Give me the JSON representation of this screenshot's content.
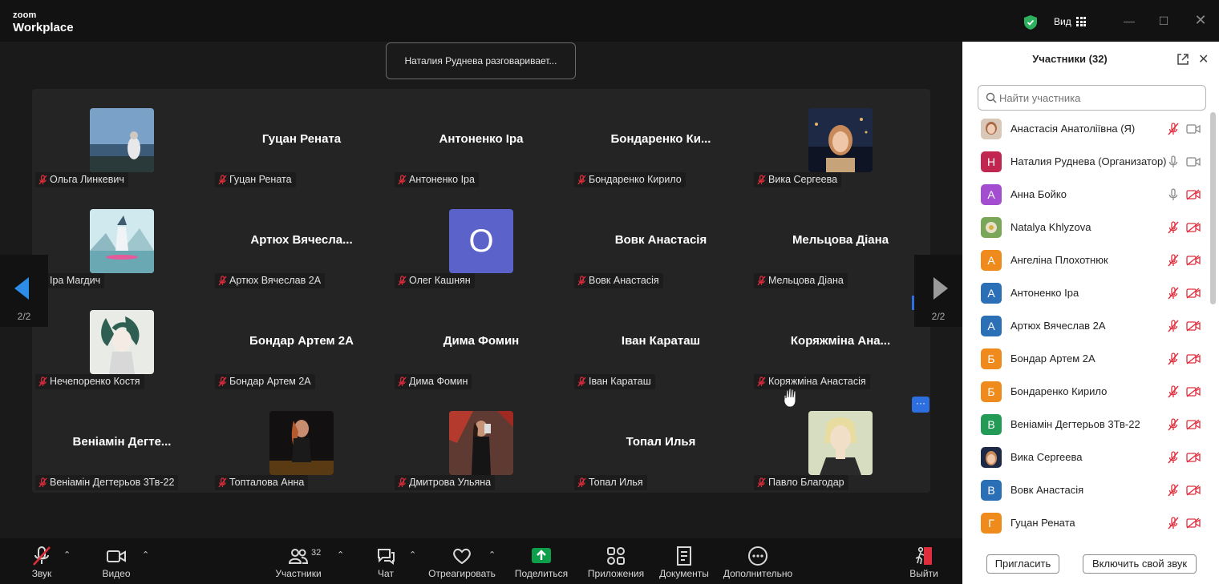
{
  "titlebar": {
    "brand_top": "zoom",
    "brand_bottom": "Workplace",
    "view_label": "Вид",
    "colors": {
      "shield": "#2db15f",
      "background": "#121212"
    }
  },
  "speaking_banner": "Наталия Руднева разговаривает...",
  "gallery": {
    "page": "2/2",
    "tiles": [
      {
        "display": "photo",
        "photo": "sea",
        "label": "Ольга Линкевич",
        "muted": true
      },
      {
        "display": "name",
        "big_name": "Гуцан Рената",
        "label": "Гуцан Рената",
        "muted": true
      },
      {
        "display": "name",
        "big_name": "Антоненко Іра",
        "label": "Антоненко Іра",
        "muted": true
      },
      {
        "display": "name",
        "big_name": "Бондаренко  Ки...",
        "label": "Бондаренко Кирило",
        "muted": true
      },
      {
        "display": "photo",
        "photo": "night",
        "label": "Вика Сергеева",
        "muted": true
      },
      {
        "display": "photo",
        "photo": "anime",
        "label": "Іра Магдич",
        "muted": false
      },
      {
        "display": "name",
        "big_name": "Артюх  Вячесла...",
        "label": "Артюх Вячеслав 2А",
        "muted": true
      },
      {
        "display": "letter",
        "letter": "О",
        "letter_color": "#5b62c9",
        "label": "Олег Кашнян",
        "muted": true
      },
      {
        "display": "name",
        "big_name": "Вовк Анастасія",
        "label": "Вовк Анастасія",
        "muted": true
      },
      {
        "display": "name",
        "big_name": "Мельцова Діана",
        "label": "Мельцова Діана",
        "muted": true
      },
      {
        "display": "photo",
        "photo": "sketch",
        "label": "Нечепоренко Костя",
        "muted": true
      },
      {
        "display": "name",
        "big_name": "Бондар Артем 2А",
        "label": "Бондар Артем 2А",
        "muted": true
      },
      {
        "display": "name",
        "big_name": "Дима Фомин",
        "label": "Дима Фомин",
        "muted": true
      },
      {
        "display": "name",
        "big_name": "Іван Караташ",
        "label": "Іван Караташ",
        "muted": true
      },
      {
        "display": "name",
        "big_name": "Коряжміна Ана...",
        "label": "Коряжміна Анастасія",
        "muted": true
      },
      {
        "display": "name",
        "big_name": "Веніамін Дегте...",
        "label": "Веніамін Дегтерьов 3Тв-22",
        "muted": true
      },
      {
        "display": "photo",
        "photo": "dark",
        "label": "Топталова Анна",
        "muted": true
      },
      {
        "display": "photo",
        "photo": "red",
        "label": "Дмитрова Ульяна",
        "muted": true
      },
      {
        "display": "name",
        "big_name": "Топал Илья",
        "label": "Топал Илья",
        "muted": true
      },
      {
        "display": "photo",
        "photo": "portrait",
        "label": "Павло Благодар",
        "muted": true
      }
    ]
  },
  "toolbar": {
    "audio": "Звук",
    "video": "Видео",
    "participants": "Участники",
    "participants_count": "32",
    "chat": "Чат",
    "react": "Отреагировать",
    "share": "Поделиться",
    "apps": "Приложения",
    "docs": "Документы",
    "more": "Дополнительно",
    "leave": "Выйти",
    "colors": {
      "share": "#0e9f4b",
      "leave": "#e02d3c",
      "muted": "#e02d3c"
    }
  },
  "panel": {
    "title": "Участники (32)",
    "search_placeholder": "Найти участника",
    "invite": "Пригласить",
    "unmute_self": "Включить свой звук",
    "participants": [
      {
        "name": "Анастасія Анатоліївна (Я)",
        "avatar": "photo-woman",
        "mic": "muted",
        "cam": "on"
      },
      {
        "name": "Наталия Руднева (Организатор)",
        "avatar": "Н",
        "color": "#c0264f",
        "mic": "on",
        "cam": "on"
      },
      {
        "name": "Анна Бойко",
        "avatar": "А",
        "color": "#a34ed1",
        "mic": "on",
        "cam": "off"
      },
      {
        "name": "Natalya Khlyzova",
        "avatar": "photo-flower",
        "mic": "muted",
        "cam": "off"
      },
      {
        "name": "Ангеліна Плохотнюк",
        "avatar": "А",
        "color": "#ef8b1c",
        "mic": "muted",
        "cam": "off"
      },
      {
        "name": "Антоненко Іра",
        "avatar": "А",
        "color": "#2b6fb7",
        "mic": "muted",
        "cam": "off"
      },
      {
        "name": "Артюх Вячеслав 2А",
        "avatar": "А",
        "color": "#2b6fb7",
        "mic": "muted",
        "cam": "off"
      },
      {
        "name": "Бондар Артем 2А",
        "avatar": "Б",
        "color": "#ef8b1c",
        "mic": "muted",
        "cam": "off"
      },
      {
        "name": "Бондаренко Кирило",
        "avatar": "Б",
        "color": "#ef8b1c",
        "mic": "muted",
        "cam": "off"
      },
      {
        "name": "Веніамін Дегтерьов 3Тв-22",
        "avatar": "В",
        "color": "#239b56",
        "mic": "muted",
        "cam": "off"
      },
      {
        "name": "Вика Сергеева",
        "avatar": "photo-night",
        "mic": "muted",
        "cam": "off"
      },
      {
        "name": "Вовк Анастасія",
        "avatar": "В",
        "color": "#2b6fb7",
        "mic": "muted",
        "cam": "off"
      },
      {
        "name": "Гуцан Рената",
        "avatar": "Г",
        "color": "#ef8b1c",
        "mic": "muted",
        "cam": "off"
      }
    ]
  }
}
